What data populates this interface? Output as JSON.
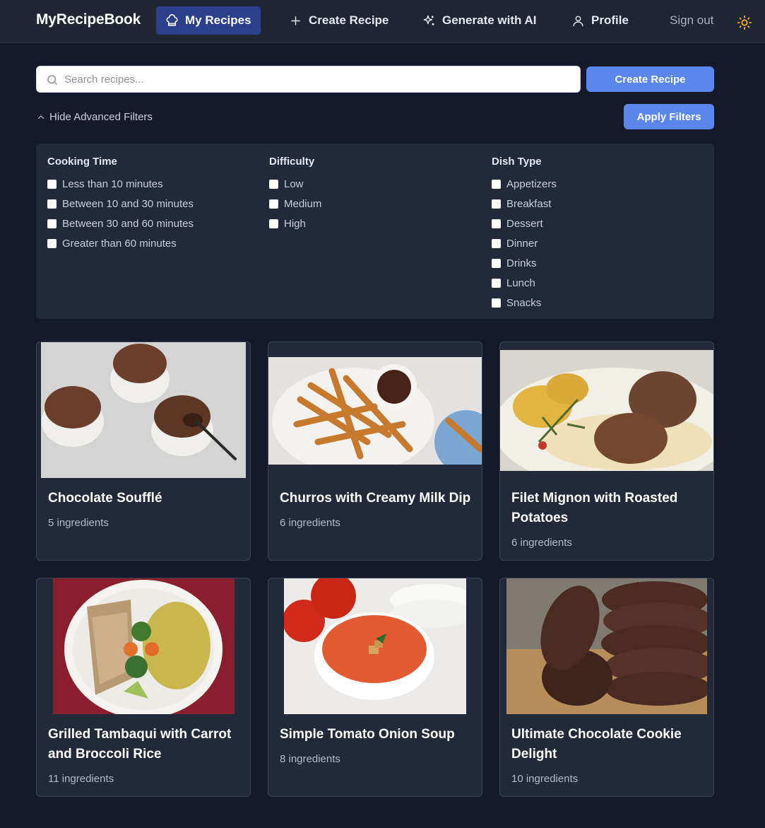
{
  "nav": {
    "brand": "MyRecipeBook",
    "items": [
      {
        "label": "My Recipes",
        "icon": "chef-hat-icon",
        "active": true
      },
      {
        "label": "Create Recipe",
        "icon": "plus-icon"
      },
      {
        "label": "Generate with AI",
        "icon": "sparkles-icon"
      },
      {
        "label": "Profile",
        "icon": "user-icon"
      }
    ],
    "signout": "Sign out",
    "theme_icon": "sun-icon"
  },
  "search": {
    "placeholder": "Search recipes...",
    "value": ""
  },
  "buttons": {
    "create": "Create Recipe",
    "apply": "Apply Filters",
    "toggle": "Hide Advanced Filters"
  },
  "filters": [
    {
      "title": "Cooking Time",
      "options": [
        "Less than 10 minutes",
        "Between 10 and 30 minutes",
        "Between 30 and 60 minutes",
        "Greater than 60 minutes"
      ]
    },
    {
      "title": "Difficulty",
      "options": [
        "Low",
        "Medium",
        "High"
      ]
    },
    {
      "title": "Dish Type",
      "options": [
        "Appetizers",
        "Breakfast",
        "Dessert",
        "Dinner",
        "Drinks",
        "Lunch",
        "Snacks"
      ]
    }
  ],
  "recipes": [
    {
      "title": "Chocolate Soufflé",
      "count": "5 ingredients"
    },
    {
      "title": "Churros with Creamy Milk Dip",
      "count": "6 ingredients"
    },
    {
      "title": "Filet Mignon with Roasted Potatoes",
      "count": "6 ingredients"
    },
    {
      "title": "Grilled Tambaqui with Carrot and Broccoli Rice",
      "count": "11 ingredients"
    },
    {
      "title": "Simple Tomato Onion Soup",
      "count": "8 ingredients"
    },
    {
      "title": "Ultimate Chocolate Cookie Delight",
      "count": "10 ingredients"
    }
  ],
  "colors": {
    "accent": "#5b86eb",
    "nav_active": "#2b3f8c",
    "background": "#141a29",
    "panel": "#222939"
  }
}
